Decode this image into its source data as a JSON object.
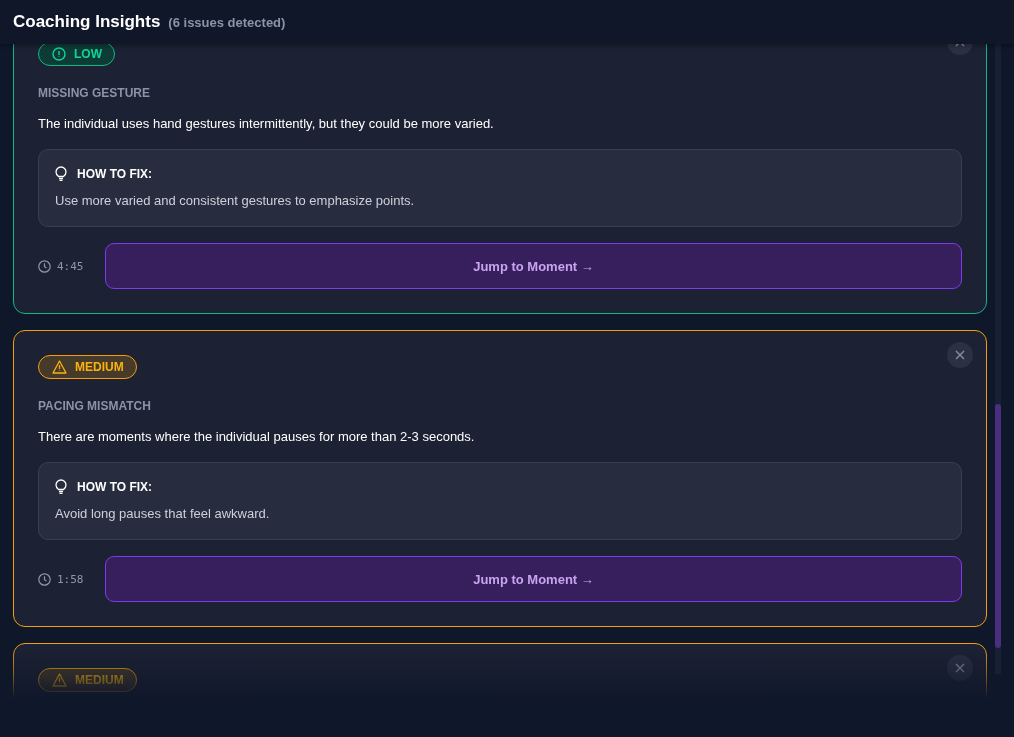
{
  "header": {
    "title": "Coaching Insights",
    "count": "(6 issues detected)"
  },
  "issues": [
    {
      "kind": "low",
      "badge": "LOW",
      "category": "MISSING GESTURE",
      "description": "The individual uses hand gestures intermittently, but they could be more varied.",
      "fix_heading": "HOW TO FIX:",
      "fix_text": "Use more varied and consistent gestures to emphasize points.",
      "time": "4:45",
      "action": "Jump to Moment →"
    },
    {
      "kind": "medium",
      "badge": "MEDIUM",
      "category": "PACING MISMATCH",
      "description": "There are moments where the individual pauses for more than 2-3 seconds.",
      "fix_heading": "HOW TO FIX:",
      "fix_text": "Avoid long pauses that feel awkward.",
      "time": "1:58",
      "action": "Jump to Moment →"
    },
    {
      "kind": "medium",
      "badge": "MEDIUM"
    }
  ]
}
